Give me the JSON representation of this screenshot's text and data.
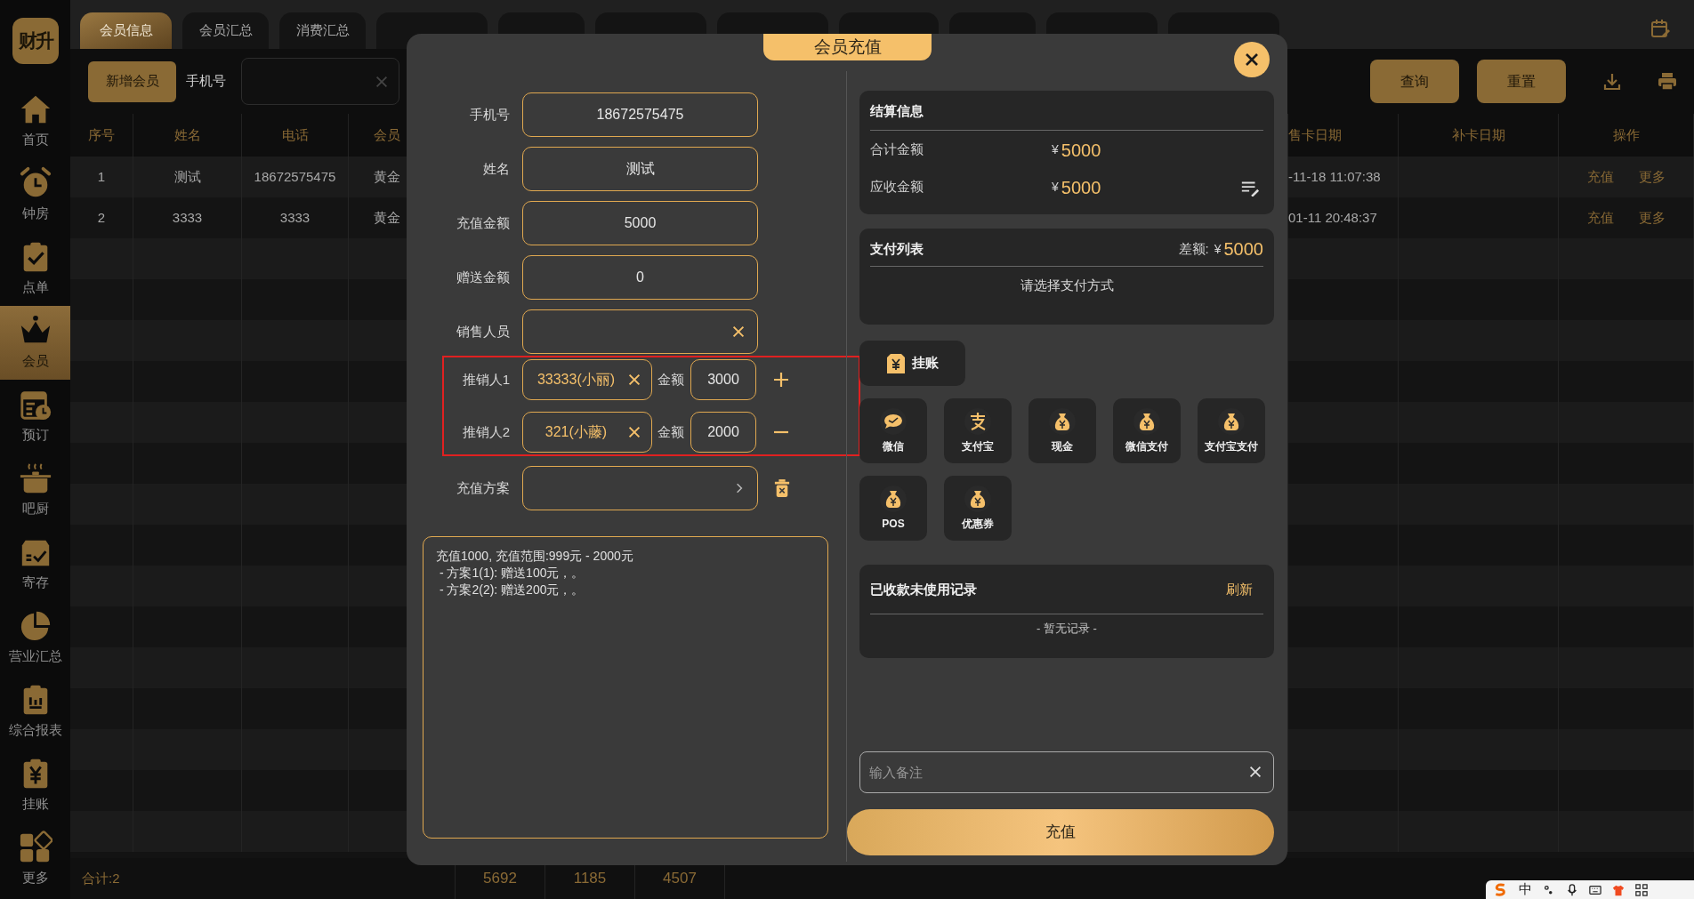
{
  "app": {
    "logo": "财升"
  },
  "sidebar": {
    "items": [
      {
        "label": "首页",
        "selected": false
      },
      {
        "label": "钟房",
        "selected": false
      },
      {
        "label": "点单",
        "selected": false
      },
      {
        "label": "会员",
        "selected": true
      },
      {
        "label": "预订",
        "selected": false
      },
      {
        "label": "吧厨",
        "selected": false
      },
      {
        "label": "寄存",
        "selected": false
      },
      {
        "label": "营业汇总",
        "selected": false
      },
      {
        "label": "综合报表",
        "selected": false
      },
      {
        "label": "挂账",
        "selected": false
      },
      {
        "label": "更多",
        "selected": false
      }
    ]
  },
  "tabs": [
    {
      "label": "会员信息",
      "selected": true
    },
    {
      "label": "会员汇总",
      "selected": false
    },
    {
      "label": "消费汇总",
      "selected": false
    },
    {
      "selected": false
    },
    {
      "selected": false
    },
    {
      "selected": false
    },
    {
      "selected": false
    },
    {
      "selected": false
    },
    {
      "selected": false
    },
    {
      "selected": false
    },
    {
      "selected": false
    }
  ],
  "toolbar": {
    "add_button": "新增会员",
    "phone_label": "手机号",
    "buttons": [
      "查询",
      "重置"
    ]
  },
  "table": {
    "columns": [
      "序号",
      "姓名",
      "电话",
      "会员",
      "售卡日期",
      "补卡日期",
      "操作"
    ],
    "rows": [
      {
        "cells": [
          "1",
          "测试",
          "18672575475",
          "黄金",
          "-11-18 11:07:38"
        ],
        "actions": [
          "充值",
          "更多"
        ]
      },
      {
        "cells": [
          "2",
          "3333",
          "3333",
          "黄金",
          "01-11 20:48:37"
        ],
        "actions": [
          "充值",
          "更多"
        ]
      }
    ],
    "footer": {
      "label": "合计:2",
      "totals": [
        "5692",
        "1185",
        "4507"
      ]
    }
  },
  "dialog": {
    "title": "会员充值",
    "form": [
      {
        "label": "手机号",
        "value": "18672575475"
      },
      {
        "label": "姓名",
        "value": "测试"
      },
      {
        "label": "充值金额",
        "value": "5000"
      },
      {
        "label": "赠送金额",
        "value": "0"
      }
    ],
    "sales_person": {
      "label": "销售人员"
    },
    "promoters": [
      {
        "label": "推销人1",
        "value": "33333(小丽)",
        "amount_label": "金额",
        "amount": "3000",
        "kind": "add"
      },
      {
        "label": "推销人2",
        "value": "321(小藤)",
        "amount_label": "金额",
        "amount": "2000",
        "kind": "remove"
      }
    ],
    "plan": {
      "label": "充值方案"
    },
    "plan_note": [
      "充值1000, 充值范围:999元 - 2000元",
      " - 方案1(1): 赠送100元，。",
      " - 方案2(2): 赠送200元，。"
    ],
    "settlement": {
      "title": "结算信息",
      "rows": [
        {
          "label": "合计金额",
          "currency": "¥",
          "amount": "5000",
          "editable": false
        },
        {
          "label": "应收金额",
          "currency": "¥",
          "amount": "5000",
          "editable": true
        }
      ]
    },
    "payments": {
      "title": "支付列表",
      "diff_label": "差额:",
      "currency": "¥",
      "diff": "5000",
      "empty": "请选择支付方式"
    },
    "credit_button": "挂账",
    "methods": [
      {
        "label": "微信",
        "kind": "chat"
      },
      {
        "label": "支付宝",
        "kind": "alipay"
      },
      {
        "label": "现金",
        "kind": "bag"
      },
      {
        "label": "微信支付",
        "kind": "bag"
      },
      {
        "label": "支付宝支付",
        "kind": "bag"
      },
      {
        "label": "POS",
        "kind": "bag"
      },
      {
        "label": "优惠券",
        "kind": "bag"
      }
    ],
    "unused": {
      "title": "已收款未使用记录",
      "refresh": "刷新",
      "empty": "- 暂无记录 -"
    },
    "remark": {
      "placeholder": "输入备注"
    },
    "submit": "充值"
  },
  "ime_bar": {
    "lang": "中"
  }
}
